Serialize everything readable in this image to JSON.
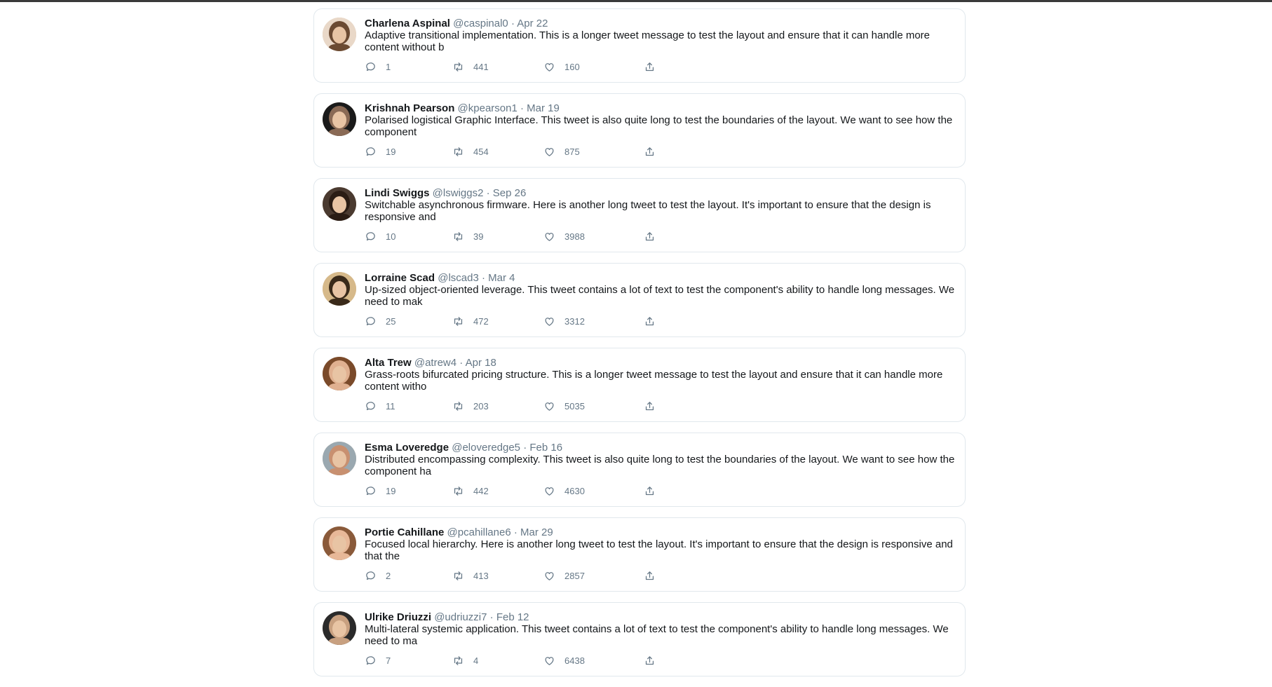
{
  "tweets": [
    {
      "name": "Charlena Aspinal",
      "handle": "@caspinal0",
      "date": "Apr 22",
      "text": "Adaptive transitional implementation. This is a longer tweet message to test the layout and ensure that it can handle more content without b",
      "replies": "1",
      "retweets": "441",
      "likes": "160",
      "avatar_bg": "#e9d8c8",
      "avatar_fg": "#6b4a32"
    },
    {
      "name": "Krishnah Pearson",
      "handle": "@kpearson1",
      "date": "Mar 19",
      "text": "Polarised logistical Graphic Interface. This tweet is also quite long to test the boundaries of the layout. We want to see how the component",
      "replies": "19",
      "retweets": "454",
      "likes": "875",
      "avatar_bg": "#1a1a1a",
      "avatar_fg": "#8a6a55"
    },
    {
      "name": "Lindi Swiggs",
      "handle": "@lswiggs2",
      "date": "Sep 26",
      "text": "Switchable asynchronous firmware. Here is another long tweet to test the layout. It's important to ensure that the design is responsive and",
      "replies": "10",
      "retweets": "39",
      "likes": "3988",
      "avatar_bg": "#4a3a30",
      "avatar_fg": "#2a1c14"
    },
    {
      "name": "Lorraine Scad",
      "handle": "@lscad3",
      "date": "Mar 4",
      "text": "Up-sized object-oriented leverage. This tweet contains a lot of text to test the component's ability to handle long messages. We need to mak",
      "replies": "25",
      "retweets": "472",
      "likes": "3312",
      "avatar_bg": "#d6b98a",
      "avatar_fg": "#3a2a1a"
    },
    {
      "name": "Alta Trew",
      "handle": "@atrew4",
      "date": "Apr 18",
      "text": "Grass-roots bifurcated pricing structure. This is a longer tweet message to test the layout and ensure that it can handle more content witho",
      "replies": "11",
      "retweets": "203",
      "likes": "5035",
      "avatar_bg": "#7a4a2a",
      "avatar_fg": "#e0b090"
    },
    {
      "name": "Esma Loveredge",
      "handle": "@eloveredge5",
      "date": "Feb 16",
      "text": "Distributed encompassing complexity. This tweet is also quite long to test the boundaries of the layout. We want to see how the component ha",
      "replies": "19",
      "retweets": "442",
      "likes": "4630",
      "avatar_bg": "#9aa8b0",
      "avatar_fg": "#c89070"
    },
    {
      "name": "Portie Cahillane",
      "handle": "@pcahillane6",
      "date": "Mar 29",
      "text": "Focused local hierarchy. Here is another long tweet to test the layout. It's important to ensure that the design is responsive and that the",
      "replies": "2",
      "retweets": "413",
      "likes": "2857",
      "avatar_bg": "#8a5a3a",
      "avatar_fg": "#e8b898"
    },
    {
      "name": "Ulrike Driuzzi",
      "handle": "@udriuzzi7",
      "date": "Feb 12",
      "text": "Multi-lateral systemic application. This tweet contains a lot of text to test the component's ability to handle long messages. We need to ma",
      "replies": "7",
      "retweets": "4",
      "likes": "6438",
      "avatar_bg": "#2a2a2a",
      "avatar_fg": "#c8a080"
    }
  ],
  "separator": "·"
}
